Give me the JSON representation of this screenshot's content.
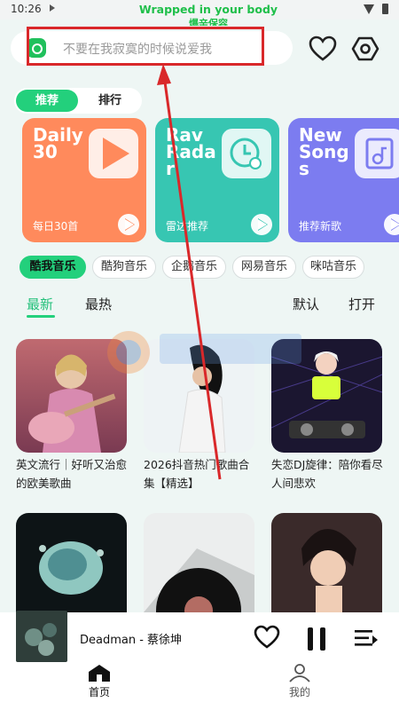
{
  "statusbar": {
    "time": "10:26"
  },
  "overlay": {
    "line1": "Wrapped in your body",
    "line2": "爆辛保容"
  },
  "search": {
    "placeholder": "不要在我寂寞的时候说爱我"
  },
  "tabs": [
    {
      "label": "推荐"
    },
    {
      "label": "排行"
    }
  ],
  "cards": [
    {
      "title": "Daily\n30",
      "subtitle": "每日30首",
      "color": "#ff8a5c",
      "icon": "play-icon"
    },
    {
      "title": "Rav\nRada\nr",
      "subtitle": "雷达推荐",
      "color": "#37c6b2",
      "icon": "clock-music-icon"
    },
    {
      "title": "New\nSong\ns",
      "subtitle": "推荐新歌",
      "color": "#7c7cf0",
      "icon": "music-file-icon"
    }
  ],
  "sources": [
    {
      "label": "酷我音乐"
    },
    {
      "label": "酷狗音乐"
    },
    {
      "label": "企鹅音乐"
    },
    {
      "label": "网易音乐"
    },
    {
      "label": "咪咕音乐"
    }
  ],
  "sort": {
    "newest": "最新",
    "hottest": "最热",
    "default": "默认",
    "open": "打开"
  },
  "playlists": [
    {
      "title": "英文流行｜好听又治愈的欧美歌曲"
    },
    {
      "title": "2026抖音热门歌曲合集【精选】"
    },
    {
      "title": "失恋DJ旋律：陪你看尽人间悲欢"
    },
    {
      "title": ""
    },
    {
      "title": ""
    },
    {
      "title": ""
    }
  ],
  "player": {
    "title": "Deadman - 蔡徐坤"
  },
  "bottom_nav": {
    "home": "首页",
    "mine": "我的"
  },
  "colors": {
    "accent": "#23d07c",
    "annotation": "#d9282a"
  }
}
